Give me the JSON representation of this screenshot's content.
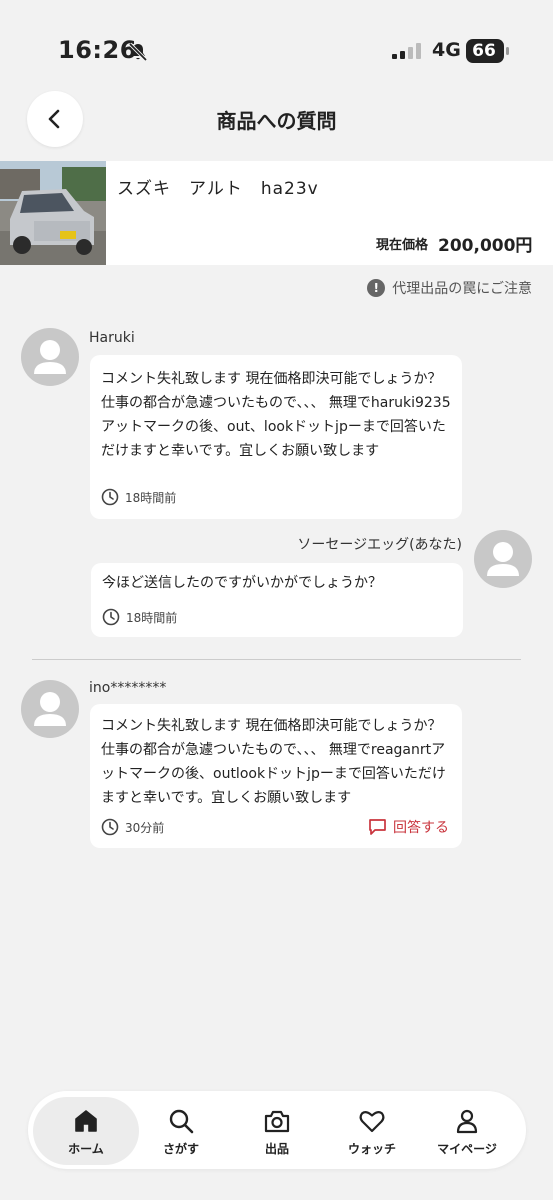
{
  "status": {
    "time": "16:26",
    "network": "4G",
    "battery": "66"
  },
  "header": {
    "title": "商品への質問"
  },
  "product": {
    "title": "スズキ　アルト　ha23v",
    "price_label": "現在価格",
    "price": "200,000円"
  },
  "warning": {
    "text": "代理出品の罠にご注意"
  },
  "comments": [
    {
      "user": "Haruki",
      "text": "コメント失礼致します 現在価格即決可能でしょうか？仕事の都合が急遽ついたもので、、、 無理でharuki9235アットマークの後、out、lookドットjpーまで回答いただけますと幸いです。宜しくお願い致します",
      "time": "18時間前"
    },
    {
      "user": "ソーセージエッグ(あなた)",
      "text": "今ほど送信したのですがいかがでしょうか？",
      "time": "18時間前"
    },
    {
      "user": "ino********",
      "text": "コメント失礼致します 現在価格即決可能でしょうか？仕事の都合が急遽ついたもので、、、 無理でreaganrtアットマークの後、outlookドットjpーまで回答いただけますと幸いです。宜しくお願い致します",
      "time": "30分前",
      "reply_label": "回答する"
    }
  ],
  "tabs": [
    {
      "label": "ホーム",
      "icon": "home-icon"
    },
    {
      "label": "さがす",
      "icon": "search-icon"
    },
    {
      "label": "出品",
      "icon": "camera-icon"
    },
    {
      "label": "ウォッチ",
      "icon": "heart-icon"
    },
    {
      "label": "マイページ",
      "icon": "person-icon"
    }
  ],
  "colors": {
    "accent_red": "#c9343d",
    "background": "#f2f2f2"
  }
}
